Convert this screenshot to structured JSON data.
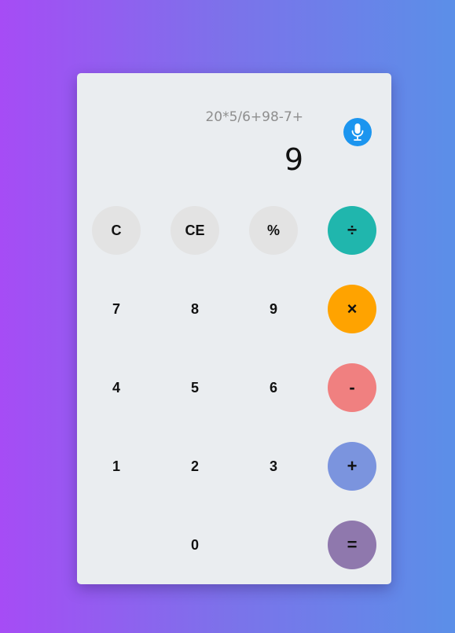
{
  "display": {
    "expression": "20*5/6+98-7+",
    "result": "9",
    "mic_icon": "microphone-icon",
    "mic_color": "#1c95ef"
  },
  "keys": {
    "clear": "C",
    "clear_entry": "CE",
    "percent": "%",
    "divide": "÷",
    "seven": "7",
    "eight": "8",
    "nine": "9",
    "multiply": "×",
    "four": "4",
    "five": "5",
    "six": "6",
    "minus": "-",
    "one": "1",
    "two": "2",
    "three": "3",
    "plus": "+",
    "zero": "0",
    "equals": "="
  },
  "colors": {
    "divide": "#20b6ad",
    "multiply": "#ffa300",
    "minus": "#f08080",
    "plus": "#7b94de",
    "equals": "#8f78ad",
    "function_keys": "#e3e3e3",
    "panel": "#eaedf0"
  }
}
